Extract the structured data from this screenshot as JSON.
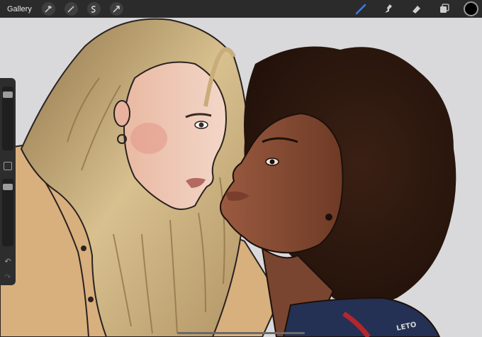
{
  "topbar": {
    "gallery_label": "Gallery",
    "left_tools": [
      "wrench-icon",
      "magic-wand-icon",
      "selection-icon",
      "transform-icon"
    ],
    "right_tools": [
      "brush-icon",
      "smudge-icon",
      "eraser-icon",
      "layers-icon"
    ],
    "active_tool": "brush-icon",
    "active_tool_color": "#3b7be8",
    "current_color": "#000000"
  },
  "sidebar": {
    "brush_size_level": 0.95,
    "opacity_level": 0.95,
    "undo_icon": "undo-icon",
    "redo_icon": "redo-icon"
  },
  "artwork": {
    "background_color": "#d9d9db",
    "jacket_right_text": "LETO"
  }
}
